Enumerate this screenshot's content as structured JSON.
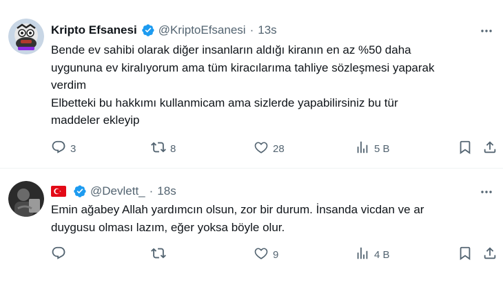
{
  "colors": {
    "text_primary": "#0f1419",
    "text_secondary": "#536471",
    "verified_blue": "#1d9bf0",
    "divider": "#eff3f4"
  },
  "tweets": [
    {
      "author_name": "Kripto Efsanesi",
      "verified": true,
      "handle": "@KriptoEfsanesi",
      "separator": "·",
      "time": "13s",
      "avatar": "cartoon-avatar",
      "text_lines": [
        "Bende ev sahibi olarak diğer insanların aldığı kiranın en az %50 daha",
        "uygununa ev kiralıyorum ama tüm kiracılarıma tahliye sözleşmesi yaparak",
        "verdim",
        "Elbetteki bu hakkımı kullanmicam ama sizlerde yapabilirsiniz bu tür",
        "maddeler ekleyip"
      ],
      "actions": {
        "replies": "3",
        "reposts": "8",
        "likes": "28",
        "views": "5 B"
      }
    },
    {
      "author_name": "",
      "flag": "turkey-flag",
      "verified": true,
      "handle": "@Devlett_",
      "separator": "·",
      "time": "18s",
      "avatar": "photo-avatar",
      "text_lines": [
        "Emin ağabey Allah yardımcın olsun, zor bir durum. İnsanda vicdan ve ar",
        "duygusu olması lazım, eğer yoksa böyle olur."
      ],
      "actions": {
        "replies": "",
        "reposts": "",
        "likes": "9",
        "views": "4 B"
      }
    }
  ]
}
